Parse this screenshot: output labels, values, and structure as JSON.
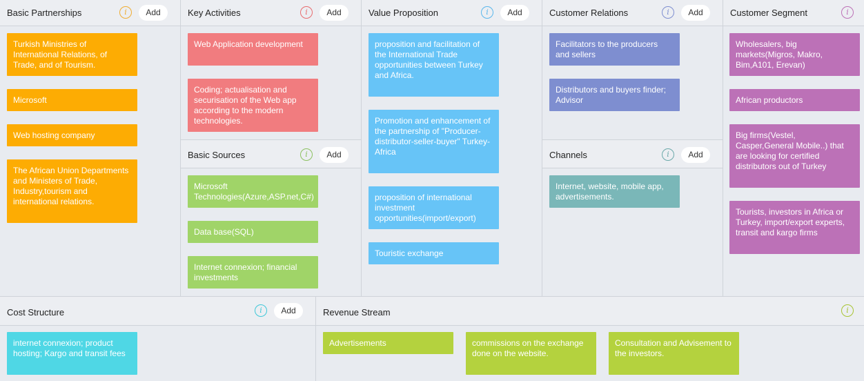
{
  "colors": {
    "orange": "#fdac03",
    "red": "#f17c7f",
    "green": "#a0d468",
    "blue": "#67c4f7",
    "indigo": "#7e8ed0",
    "teal": "#7ab7b8",
    "purple": "#bc71b7",
    "cyan": "#4fd7e5",
    "lime": "#b4d23e"
  },
  "common": {
    "add_label": "Add",
    "info_glyph": "i"
  },
  "partnerships": {
    "title": "Basic Partnerships",
    "cards": [
      "Turkish Ministries of International Relations, of Trade, and of Tourism.",
      "Microsoft",
      "Web hosting company",
      "The African Union Departments and Ministers of Trade, Industry,tourism and international relations."
    ]
  },
  "activities": {
    "title": "Key Activities",
    "cards": [
      "Web Application development",
      "Coding; actualisation and securisation of the Web app according to the modern technologies."
    ]
  },
  "sources": {
    "title": "Basic Sources",
    "cards": [
      "Microsoft Technologies(Azure,ASP.net,C#)",
      "Data base(SQL)",
      "Internet connexion; financial investments"
    ]
  },
  "value": {
    "title": "Value Proposition",
    "cards": [
      "proposition and facilitation of the International Trade opportunities between Turkey and Africa.",
      "Promotion and enhancement of the partnership of \"Producer-distributor-seller-buyer\" Turkey-Africa",
      "proposition of international investment opportunities(import/export)",
      "Touristic exchange"
    ]
  },
  "relations": {
    "title": "Customer Relations",
    "cards": [
      "Facilitators to the producers and sellers",
      "Distributors and buyers finder; Advisor"
    ]
  },
  "channels": {
    "title": "Channels",
    "cards": [
      "Internet, website, mobile app, advertisements."
    ]
  },
  "segment": {
    "title": "Customer Segment",
    "cards": [
      "Wholesalers, big markets(Migros, Makro, Bim,A101, Erevan)",
      "African productors",
      "Big firms(Vestel, Casper,General Mobile..) that are looking for certified distributors out of Turkey",
      "Tourists, investors in Africa or Turkey, import/export experts, transit and kargo firms"
    ]
  },
  "cost": {
    "title": "Cost Structure",
    "cards": [
      "internet connexion; product hosting; Kargo and transit fees"
    ]
  },
  "revenue": {
    "title": "Revenue Stream",
    "cards": [
      "Advertisements",
      "commissions on the exchange done on the website.",
      "Consultation and Advisement to the investors."
    ]
  }
}
